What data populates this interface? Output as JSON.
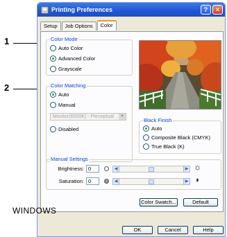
{
  "callouts": [
    "1",
    "2"
  ],
  "window": {
    "title": "Printing Preferences",
    "help_button": "?",
    "close_button": "✕"
  },
  "tabs": [
    {
      "label": "Setup",
      "active": false
    },
    {
      "label": "Job Options",
      "active": false
    },
    {
      "label": "Color",
      "active": true
    }
  ],
  "color_mode": {
    "legend": "Color Mode",
    "options": [
      {
        "label": "Auto Color",
        "selected": false
      },
      {
        "label": "Advanced Color",
        "selected": true
      },
      {
        "label": "Grayscale",
        "selected": false
      }
    ]
  },
  "color_matching": {
    "legend": "Color Matching",
    "options": [
      {
        "label": "Auto",
        "selected": true
      },
      {
        "label": "Manual",
        "selected": false
      },
      {
        "label": "Disabled",
        "selected": false
      }
    ],
    "profile_select": "Monitor(6500K) - Perceptual"
  },
  "black_finish": {
    "legend": "Black Finish",
    "options": [
      {
        "label": "Auto",
        "selected": true
      },
      {
        "label": "Composite Black (CMYK)",
        "selected": false
      },
      {
        "label": "True Black (K)",
        "selected": false
      }
    ]
  },
  "manual_settings": {
    "legend": "Manual Settings",
    "brightness": {
      "label": "Brightness:",
      "value": "0"
    },
    "saturation": {
      "label": "Saturation:",
      "value": "0"
    }
  },
  "buttons": {
    "color_swatch": "Color Swatch...",
    "default": "Default",
    "ok": "OK",
    "cancel": "Cancel",
    "help": "Help"
  },
  "os_label": "WINDOWS",
  "colors": {
    "title_bar": "#1f55d5",
    "legend_text": "#0046d5",
    "dialog_bg": "#ece9d8",
    "panel_bg": "#fcfcfe",
    "radio_dot": "#21a121"
  }
}
